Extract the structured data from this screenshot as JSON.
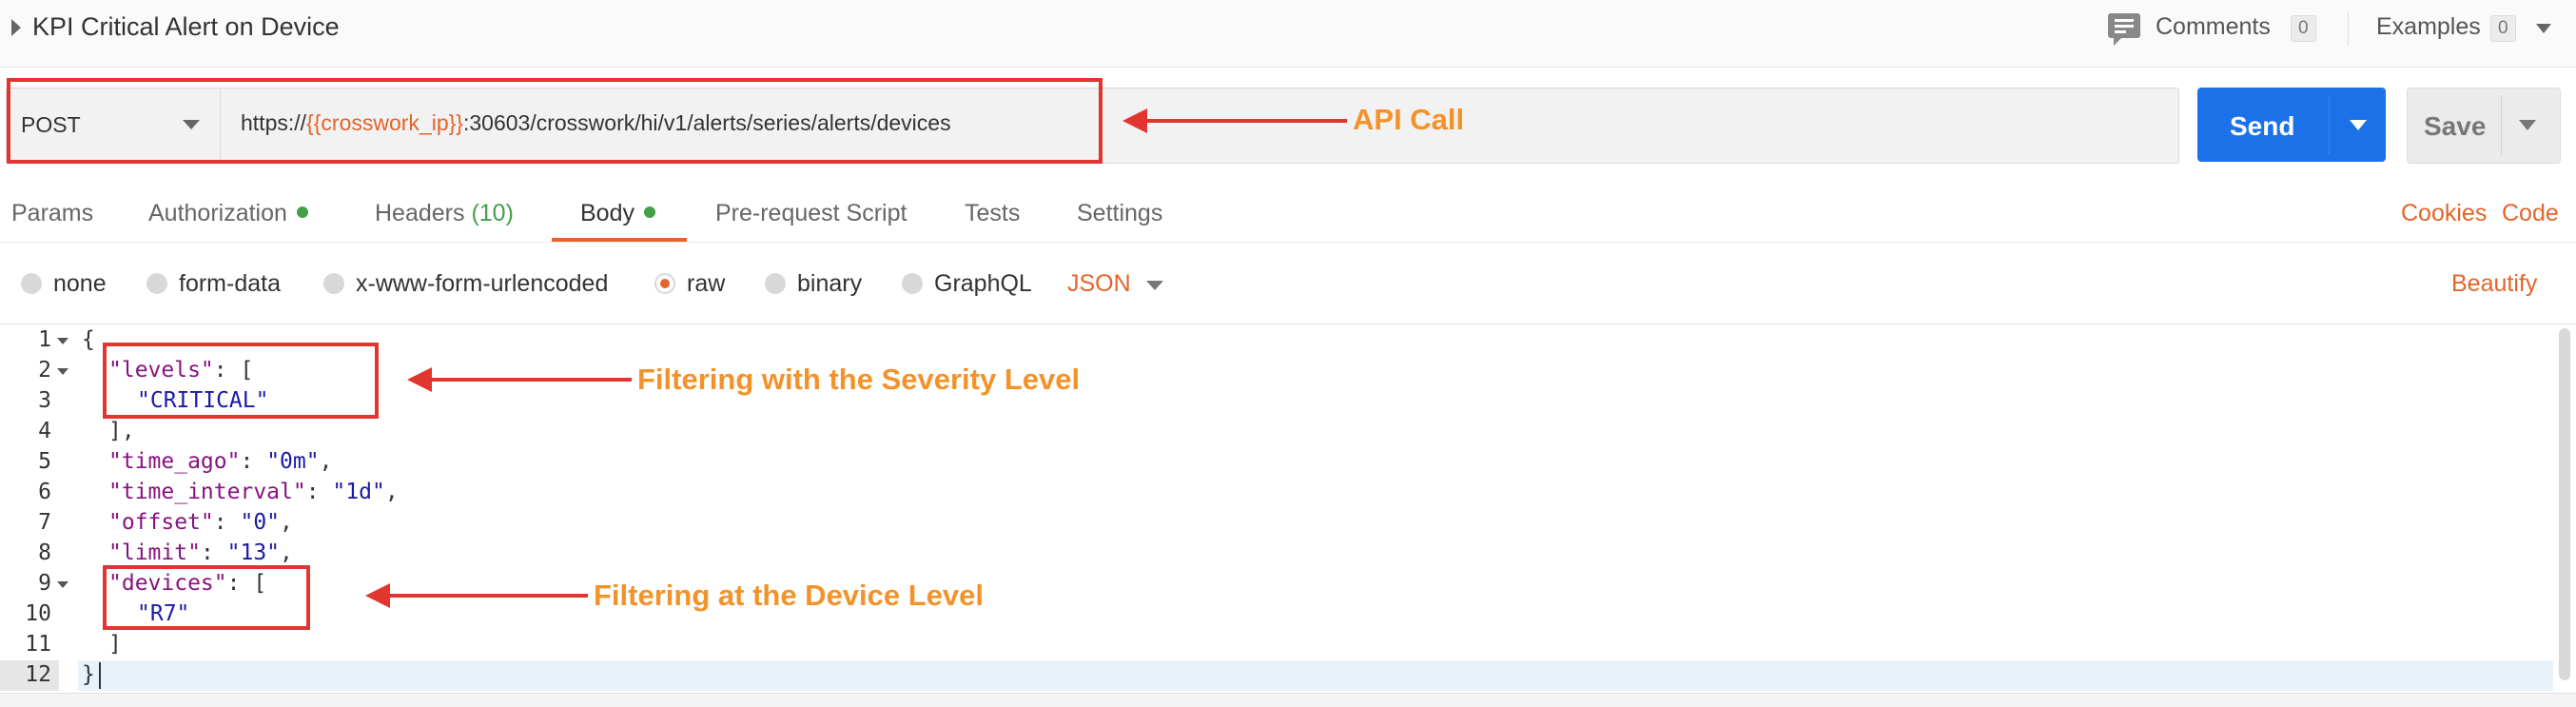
{
  "header": {
    "title": "KPI Critical Alert on Device",
    "comments_label": "Comments",
    "comments_count": "0",
    "examples_label": "Examples",
    "examples_count": "0"
  },
  "request": {
    "method": "POST",
    "url_prefix": "https://",
    "url_variable": "{{crosswork_ip}}",
    "url_suffix": ":30603/crosswork/hi/v1/alerts/series/alerts/devices",
    "send_label": "Send",
    "save_label": "Save"
  },
  "tabs": {
    "params": "Params",
    "authorization": "Authorization",
    "headers": "Headers",
    "headers_count": "(10)",
    "body": "Body",
    "prerequest": "Pre-request Script",
    "tests": "Tests",
    "settings": "Settings",
    "cookies": "Cookies",
    "code": "Code"
  },
  "body_types": {
    "none": "none",
    "form_data": "form-data",
    "urlencoded": "x-www-form-urlencoded",
    "raw": "raw",
    "binary": "binary",
    "graphql": "GraphQL",
    "format": "JSON",
    "beautify": "Beautify"
  },
  "editor": {
    "line_numbers": [
      "1",
      "2",
      "3",
      "4",
      "5",
      "6",
      "7",
      "8",
      "9",
      "10",
      "11",
      "12"
    ],
    "lines": [
      {
        "key": "",
        "value": "",
        "text": "{"
      },
      {
        "key": "\"levels\"",
        "value": "",
        "text": ": ["
      },
      {
        "key": "",
        "value": "\"CRITICAL\"",
        "text": ""
      },
      {
        "key": "",
        "value": "",
        "text": "],"
      },
      {
        "key": "\"time_ago\"",
        "value": "\"0m\"",
        "text": ","
      },
      {
        "key": "\"time_interval\"",
        "value": "\"1d\"",
        "text": ","
      },
      {
        "key": "\"offset\"",
        "value": "\"0\"",
        "text": ","
      },
      {
        "key": "\"limit\"",
        "value": "\"13\"",
        "text": ","
      },
      {
        "key": "\"devices\"",
        "value": "",
        "text": ": ["
      },
      {
        "key": "",
        "value": "\"R7\"",
        "text": ""
      },
      {
        "key": "",
        "value": "",
        "text": "]"
      },
      {
        "key": "",
        "value": "",
        "text": "}"
      }
    ]
  },
  "annotations": {
    "api_call": "API Call",
    "severity": "Filtering with the Severity Level",
    "device": "Filtering at the Device Level"
  },
  "colors": {
    "accent": "#e4642a",
    "send": "#1b72e8",
    "annotation_box": "#e2352f",
    "annotation_text": "#f4922a",
    "status_dot": "#43a047"
  }
}
